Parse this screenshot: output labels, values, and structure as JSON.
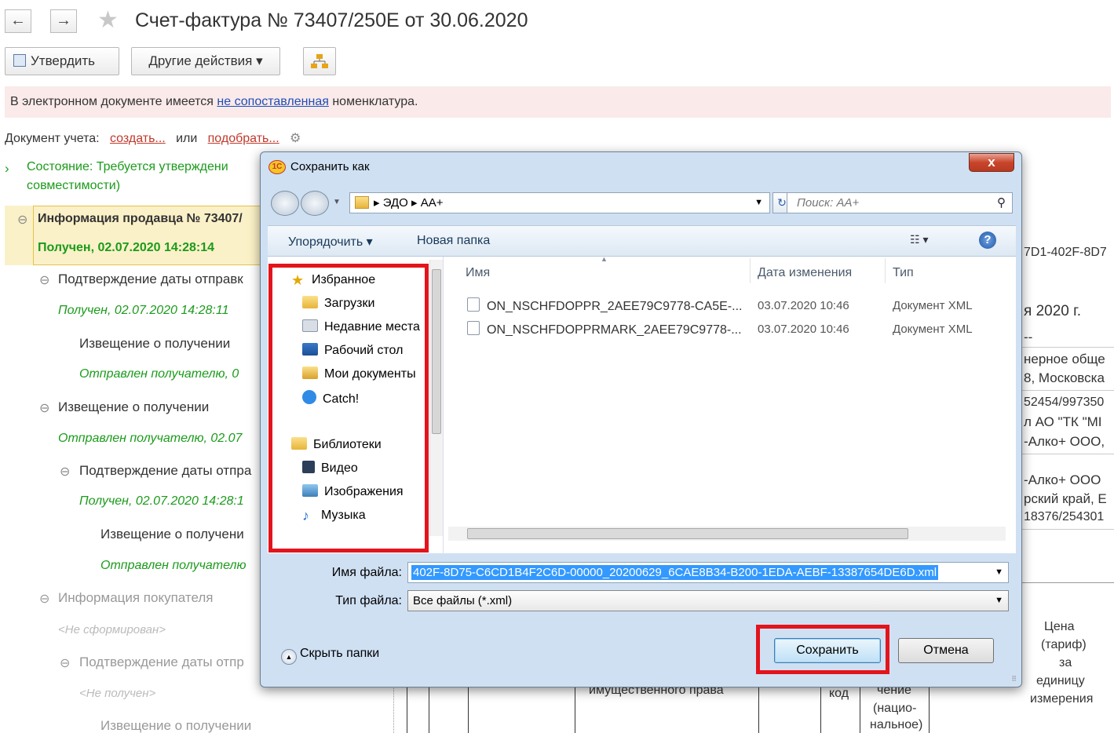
{
  "header": {
    "back": "←",
    "forward": "→",
    "title": "Счет-фактура № 73407/250Е от 30.06.2020",
    "approve_label": "Утвердить",
    "other_actions_label": "Другие действия ▾"
  },
  "banner": {
    "prefix": "В электронном документе имеется",
    "link": "не сопоставленная",
    "suffix": "номенклатура."
  },
  "accounting": {
    "label": "Документ учета:",
    "create": "создать...",
    "or": "или",
    "pick": "подобрать..."
  },
  "state": {
    "line1": "Состояние: Требуется утверждени",
    "line2": "совместимости)"
  },
  "tree": [
    {
      "text": "Информация продавца № 73407/",
      "bold": true
    },
    {
      "text": "Получен, 02.07.2020 14:28:14",
      "bold": true
    },
    {
      "text": "Подтверждение даты отправк"
    },
    {
      "text": "Получен, 02.07.2020 14:28:11"
    },
    {
      "text": "Извещение о получении"
    },
    {
      "text": "Отправлен получателю, 0"
    },
    {
      "text": "Извещение о получении"
    },
    {
      "text": "Отправлен получателю, 02.07"
    },
    {
      "text": "Подтверждение даты отпра"
    },
    {
      "text": "Получен, 02.07.2020 14:28:1"
    },
    {
      "text": "Извещение о получени"
    },
    {
      "text": "Отправлен получателю"
    },
    {
      "text": "Информация покупателя"
    },
    {
      "text": "<Не сформирован>"
    },
    {
      "text": "Подтверждение даты отпр"
    },
    {
      "text": "<Не получен>"
    },
    {
      "text": "Извещение о получении"
    }
  ],
  "right_bg": {
    "guid": "7D1-402F-8D7",
    "date": "я 2020 г.",
    "dash": "--",
    "r1": "нерное обще",
    "r2": "8, Московска",
    "r3": "52454/997350",
    "r4": "л АО \"ТК \"МІ",
    "r5": "-Алко+ ООО,",
    "r6": "-Алко+ ООО",
    "r7": "рский край, Е",
    "r8": "18376/254301",
    "price1": "Цена",
    "price2": "(тариф)",
    "price3": "за",
    "price4": "единицу",
    "price5": "измерения",
    "col_prop": "имущественного права",
    "col_code": "код",
    "col_n1": "чение",
    "col_n2": "(нацио-",
    "col_n3": "нальное)"
  },
  "dialog": {
    "title": "Сохранить как",
    "close": "x",
    "breadcrumb": [
      "ЭДО",
      "АА+"
    ],
    "search_placeholder": "Поиск: АА+",
    "organize_label": "Упорядочить ▾",
    "new_folder_label": "Новая папка",
    "nav": {
      "favorites": "Избранное",
      "downloads": "Загрузки",
      "recent": "Недавние места",
      "desktop": "Рабочий стол",
      "documents": "Мои документы",
      "catch": "Catch!",
      "libraries": "Библиотеки",
      "video": "Видео",
      "images": "Изображения",
      "music": "Музыка"
    },
    "columns": {
      "name": "Имя",
      "date": "Дата изменения",
      "type": "Тип"
    },
    "files": [
      {
        "name": "ON_NSCHFDOPPR_2AEE79C9778-CA5E-...",
        "date": "03.07.2020 10:46",
        "type": "Документ XML"
      },
      {
        "name": "ON_NSCHFDOPPRMARK_2AEE79C9778-...",
        "date": "03.07.2020 10:46",
        "type": "Документ XML"
      }
    ],
    "filename_label": "Имя файла:",
    "filename_value": "402F-8D75-C6CD1B4F2C6D-00000_20200629_6CAE8B34-B200-1EDA-AEBF-13387654DE6D.xml",
    "filetype_label": "Тип файла:",
    "filetype_value": "Все файлы (*.xml)",
    "hide_folders": "Скрыть папки",
    "save": "Сохранить",
    "cancel": "Отмена"
  },
  "colors": {
    "highlight_box": "#e3141c",
    "link": "#1f4fb5",
    "green": "#1b9b1b"
  }
}
